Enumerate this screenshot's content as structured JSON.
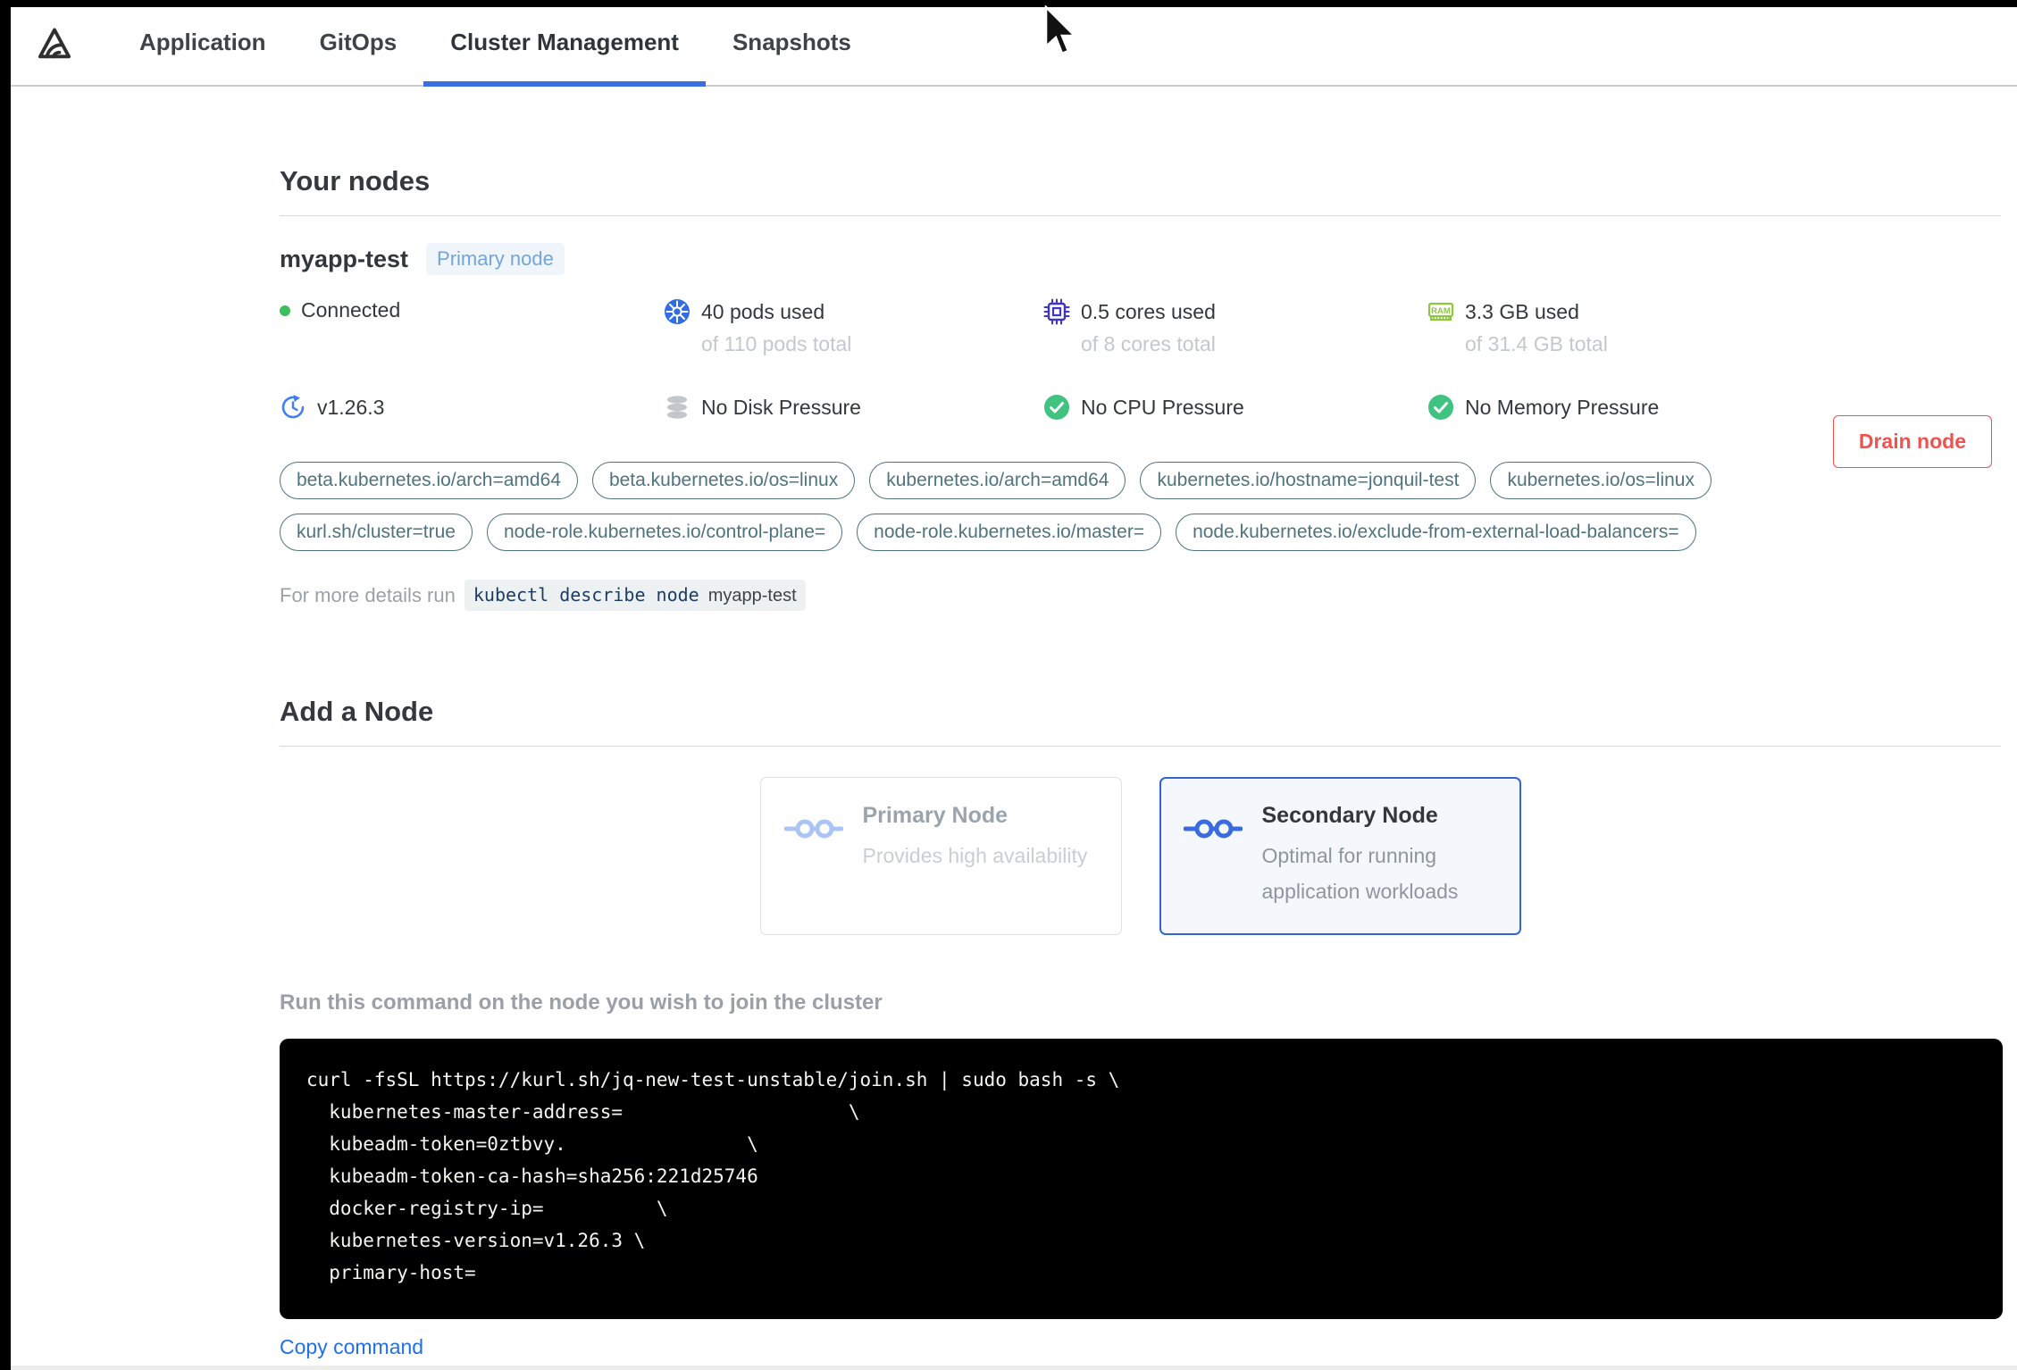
{
  "nav": {
    "logo_icon": "kurl-logo",
    "tabs": [
      {
        "label": "Application",
        "active": false
      },
      {
        "label": "GitOps",
        "active": false
      },
      {
        "label": "Cluster Management",
        "active": true
      },
      {
        "label": "Snapshots",
        "active": false
      }
    ]
  },
  "your_nodes": {
    "title": "Your nodes",
    "node": {
      "name": "myapp-test",
      "badge": "Primary node",
      "status": "Connected",
      "version": "v1.26.3",
      "stats": [
        {
          "icon": "kubernetes-pods-icon",
          "used": "40 pods used",
          "total": "of 110 pods total"
        },
        {
          "icon": "cpu-icon",
          "used": "0.5 cores used",
          "total": "of 8 cores total"
        },
        {
          "icon": "ram-icon",
          "used": "3.3 GB used",
          "total": "of 31.4 GB total"
        }
      ],
      "conditions": [
        {
          "icon": "disk-icon",
          "label": "No Disk Pressure"
        },
        {
          "icon": "check-circle-icon",
          "label": "No CPU Pressure"
        },
        {
          "icon": "check-circle-icon",
          "label": "No Memory Pressure"
        }
      ],
      "labels": [
        "beta.kubernetes.io/arch=amd64",
        "beta.kubernetes.io/os=linux",
        "kubernetes.io/arch=amd64",
        "kubernetes.io/hostname=jonquil-test",
        "kubernetes.io/os=linux",
        "kurl.sh/cluster=true",
        "node-role.kubernetes.io/control-plane=",
        "node-role.kubernetes.io/master=",
        "node.kubernetes.io/exclude-from-external-load-balancers="
      ],
      "details": {
        "prefix": "For more details run",
        "command": "kubectl describe node",
        "node_name": "myapp-test"
      },
      "drain_button": "Drain node"
    }
  },
  "add_node": {
    "title": "Add a Node",
    "cards": [
      {
        "icon": "linked-nodes-icon",
        "title": "Primary Node",
        "subtitle": "Provides high availability",
        "selected": false
      },
      {
        "icon": "linked-nodes-icon",
        "title": "Secondary Node",
        "subtitle": "Optimal for running application workloads",
        "selected": true
      }
    ],
    "instruction": "Run this command on the node you wish to join the cluster",
    "command_lines": [
      "curl -fsSL https://kurl.sh/jq-new-test-unstable/join.sh | sudo bash -s \\",
      "  kubernetes-master-address=                    \\",
      "  kubeadm-token=0ztbvy.                \\",
      "  kubeadm-token-ca-hash=sha256:221d25746",
      "  docker-registry-ip=          \\",
      "  kubernetes-version=v1.26.3 \\",
      "  primary-host="
    ],
    "copy_label": "Copy command"
  },
  "colors": {
    "accent_blue": "#3b6ede",
    "link_blue": "#2170e8",
    "danger_red": "#f0524f",
    "success_green": "#3fc380",
    "status_dot_green": "#3fbe5e",
    "label_teal": "#4f747e",
    "badge_blue": "#74a4d9",
    "kubernetes_blue": "#326ce5",
    "cpu_indigo": "#4034c8",
    "ram_green": "#8dc63f"
  }
}
